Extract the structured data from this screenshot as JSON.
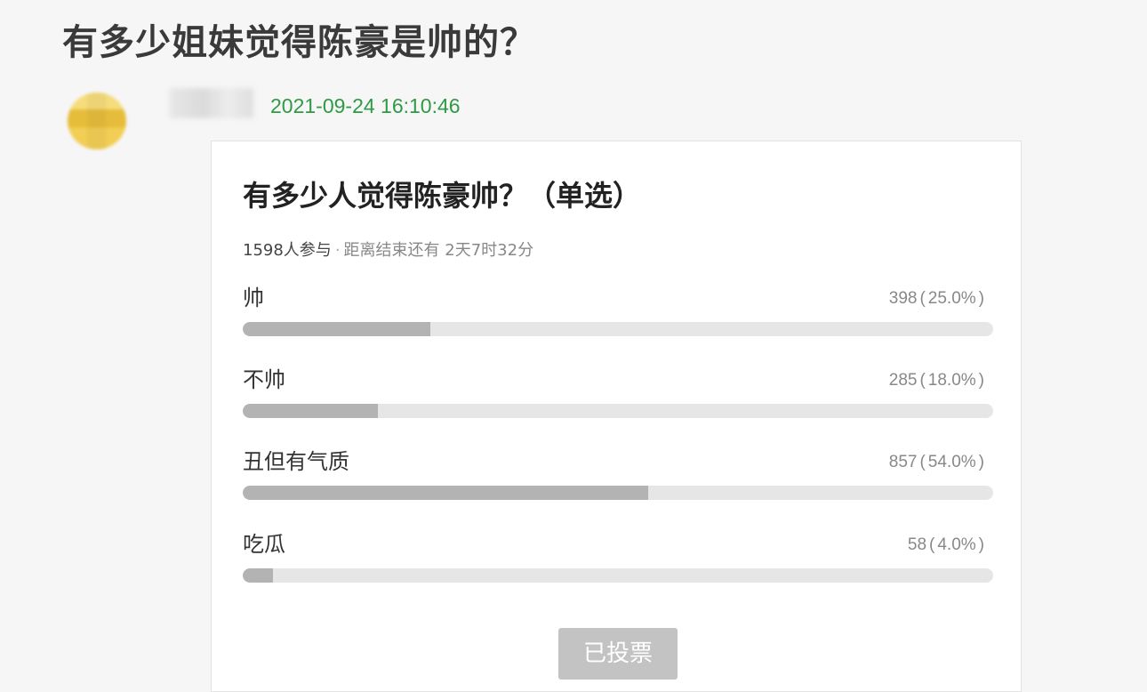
{
  "post": {
    "title": "有多少姐妹觉得陈豪是帅的？",
    "timestamp": "2021-09-24 16:10:46"
  },
  "poll": {
    "title": "有多少人觉得陈豪帅？（单选）",
    "participants": "1598人参与",
    "separator": "·",
    "deadline": "距离结束还有 2天7时32分",
    "options": [
      {
        "label": "帅",
        "count": "398",
        "percent": "25.0%",
        "fraction": 0.25
      },
      {
        "label": "不帅",
        "count": "285",
        "percent": "18.0%",
        "fraction": 0.18
      },
      {
        "label": "丑但有气质",
        "count": "857",
        "percent": "54.0%",
        "fraction": 0.54
      },
      {
        "label": "吃瓜",
        "count": "58",
        "percent": "4.0%",
        "fraction": 0.04
      }
    ],
    "button_label": "已投票"
  },
  "colors": {
    "timestamp": "#2e9a45",
    "bar_fill": "#b3b3b3",
    "bar_track": "#e6e6e6",
    "button_bg": "#c3c3c3"
  },
  "icons": {
    "avatar": "avatar-blurred",
    "username": "username-blurred"
  }
}
